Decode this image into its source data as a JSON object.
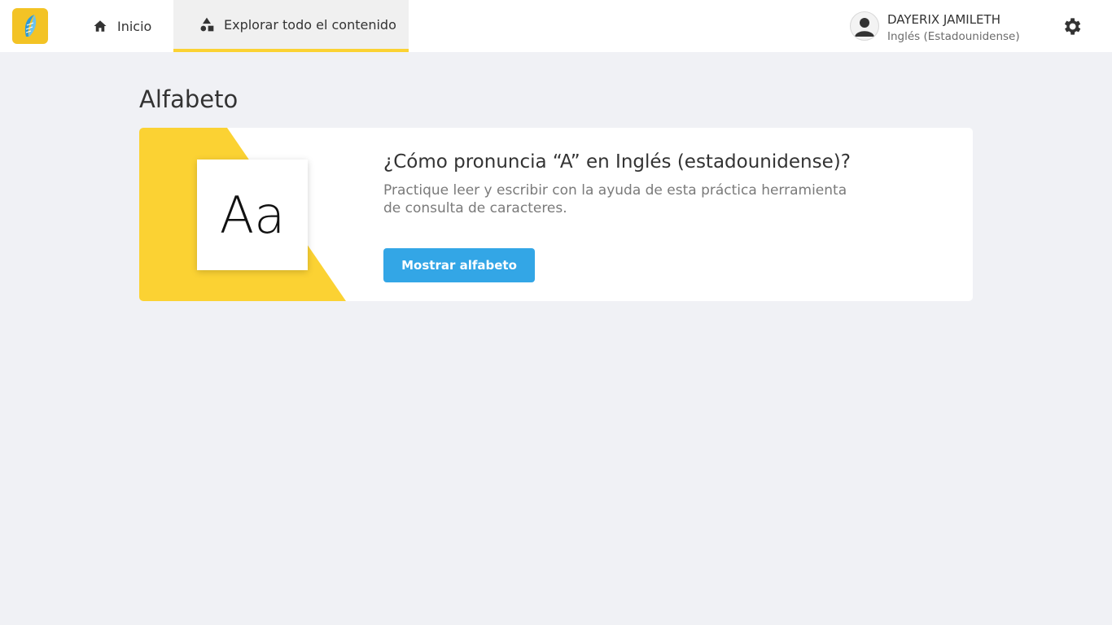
{
  "nav": {
    "items": [
      {
        "label": "Inicio",
        "icon": "home-icon"
      },
      {
        "label": "Explorar todo el contenido",
        "icon": "shapes-icon",
        "active": true
      }
    ]
  },
  "user": {
    "name": "DAYERIX JAMILETH",
    "language": "Inglés (Estadounidense)"
  },
  "page": {
    "title": "Alfabeto"
  },
  "card": {
    "tile_text": "Aa",
    "heading": "¿Cómo pronuncia “A” en Inglés (estadounidense)?",
    "description": "Practique leer y escribir con la ayuda de esta práctica herramienta de consulta de caracteres.",
    "button_label": "Mostrar alfabeto"
  },
  "colors": {
    "accent_yellow": "#fbd233",
    "logo_yellow": "#f3c325",
    "button_blue": "#33a6e6",
    "page_bg": "#f0f1f5"
  }
}
